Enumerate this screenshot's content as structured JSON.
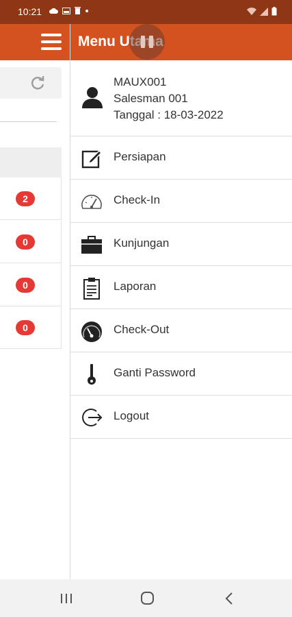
{
  "status_bar": {
    "time": "10:21"
  },
  "drawer": {
    "title": "Menu Utama",
    "profile": {
      "code": "MAUX001",
      "name": "Salesman 001",
      "date": "Tanggal : 18-03-2022"
    },
    "menu": [
      {
        "label": "Persiapan",
        "icon": "edit-icon"
      },
      {
        "label": "Check-In",
        "icon": "speedometer-icon"
      },
      {
        "label": "Kunjungan",
        "icon": "briefcase-icon"
      },
      {
        "label": "Laporan",
        "icon": "clipboard-icon"
      },
      {
        "label": "Check-Out",
        "icon": "gauge-filled-icon"
      },
      {
        "label": "Ganti Password",
        "icon": "key-icon"
      },
      {
        "label": "Logout",
        "icon": "logout-icon"
      }
    ]
  },
  "background_list": {
    "badges": [
      "2",
      "0",
      "0",
      "0"
    ]
  },
  "colors": {
    "app_bar": "#d4521f",
    "status_bar": "#8f3614",
    "badge": "#e53935"
  }
}
